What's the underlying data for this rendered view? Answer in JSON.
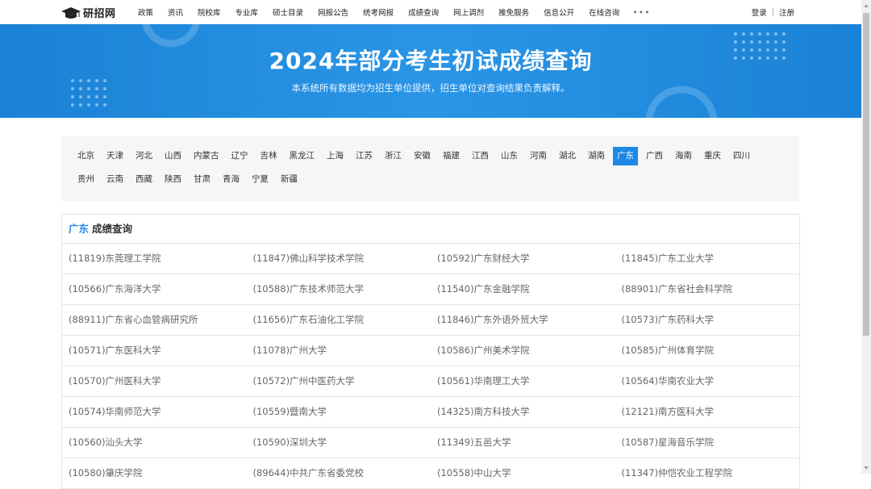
{
  "nav": {
    "logo_text": "研招网",
    "items": [
      "政策",
      "资讯",
      "院校库",
      "专业库",
      "硕士目录",
      "网报公告",
      "统考网报",
      "成绩查询",
      "网上调剂",
      "推免服务",
      "信息公开",
      "在线咨询"
    ],
    "more": "•••",
    "login": "登录",
    "separator": "|",
    "register": "注册"
  },
  "banner": {
    "title": "2024年部分考生初试成绩查询",
    "subtitle": "本系统所有数据均为招生单位提供，招生单位对查询结果负责解释。"
  },
  "regions": {
    "row1": [
      "北京",
      "天津",
      "河北",
      "山西",
      "内蒙古",
      "辽宁",
      "吉林",
      "黑龙江",
      "上海",
      "江苏",
      "浙江",
      "安徽",
      "福建",
      "江西",
      "山东",
      "河南",
      "湖北",
      "湖南",
      "广东",
      "广西",
      "海南",
      "重庆",
      "四川"
    ],
    "row2": [
      "贵州",
      "云南",
      "西藏",
      "陕西",
      "甘肃",
      "青海",
      "宁夏",
      "新疆"
    ],
    "active": "广东"
  },
  "results": {
    "province": "广东",
    "heading": "成绩查询",
    "rows": [
      [
        "(11819)东莞理工学院",
        "(11847)佛山科学技术学院",
        "(10592)广东财经大学",
        "(11845)广东工业大学"
      ],
      [
        "(10566)广东海洋大学",
        "(10588)广东技术师范大学",
        "(11540)广东金融学院",
        "(88901)广东省社会科学院"
      ],
      [
        "(88911)广东省心血管病研究所",
        "(11656)广东石油化工学院",
        "(11846)广东外语外贸大学",
        "(10573)广东药科大学"
      ],
      [
        "(10571)广东医科大学",
        "(11078)广州大学",
        "(10586)广州美术学院",
        "(10585)广州体育学院"
      ],
      [
        "(10570)广州医科大学",
        "(10572)广州中医药大学",
        "(10561)华南理工大学",
        "(10564)华南农业大学"
      ],
      [
        "(10574)华南师范大学",
        "(10559)暨南大学",
        "(14325)南方科技大学",
        "(12121)南方医科大学"
      ],
      [
        "(10560)汕头大学",
        "(10590)深圳大学",
        "(11349)五邑大学",
        "(10587)星海音乐学院"
      ],
      [
        "(10580)肇庆学院",
        "(89644)中共广东省委党校",
        "(10558)中山大学",
        "(11347)仲恺农业工程学院"
      ]
    ]
  },
  "colors": {
    "accent": "#1e88e5",
    "banner": "#2a95e6",
    "panel_bg": "#f5f6f7"
  }
}
